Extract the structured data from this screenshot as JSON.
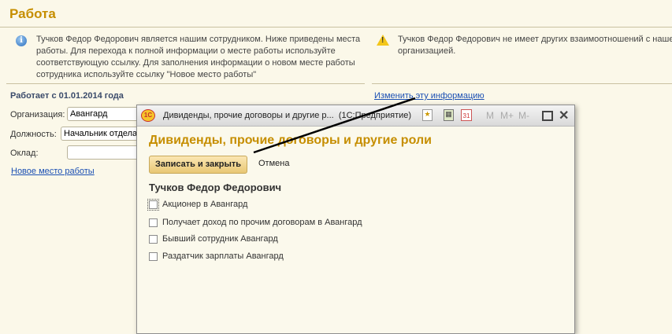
{
  "page": {
    "title": "Работа",
    "info_text": "Тучков Федор Федорович является нашим сотрудником. Ниже приведены места работы. Для перехода к полной информации о месте работы используйте соответствующую ссылку. Для заполнения информации о новом месте работы сотрудника используйте ссылку \"Новое место работы\"",
    "warning_text": "Тучков Федор Федорович не имеет других взаимоотношений с нашей организацией.",
    "works_since": "Работает с 01.01.2014 года",
    "change_link": "Изменить эту информацию",
    "org_label": "Организация:",
    "org_value": "Авангард",
    "position_label": "Должность:",
    "position_value": "Начальник отдела",
    "salary_label": "Оклад:",
    "salary_value": "",
    "new_job_link": "Новое место работы"
  },
  "dialog": {
    "window_title": "Дивиденды, прочие договоры и другие р...  (1С:Предприятие)",
    "heading": "Дивиденды, прочие договоры и другие роли",
    "save_close": "Записать и закрыть",
    "cancel": "Отмена",
    "person": "Тучков Федор Федорович",
    "toolbar": {
      "m": "M",
      "mplus": "M+",
      "mminus": "M-",
      "calendar": "31"
    },
    "options": [
      {
        "label": "Акционер в Авангард",
        "checked": false
      },
      {
        "label": "Получает доход по прочим договорам в Авангард",
        "checked": false
      },
      {
        "label": "Бывший сотрудник Авангард",
        "checked": false
      },
      {
        "label": "Раздатчик зарплаты Авангард",
        "checked": false
      }
    ]
  }
}
